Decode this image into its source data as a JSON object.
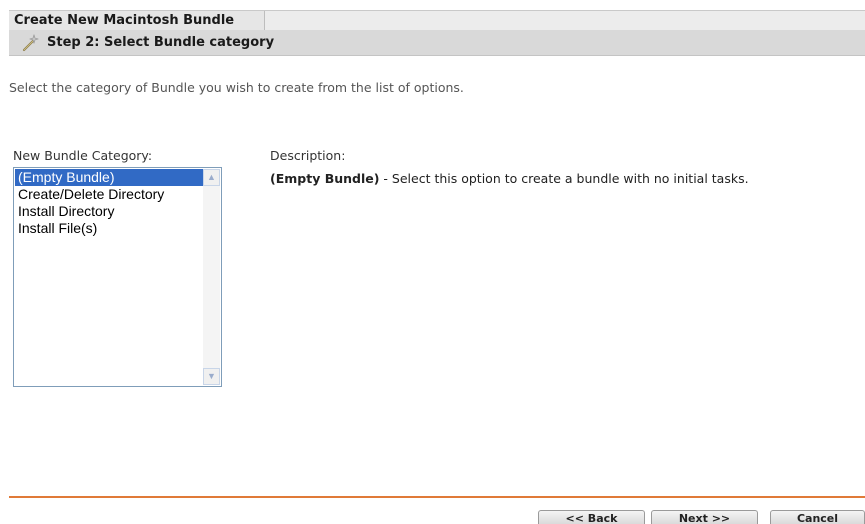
{
  "header": {
    "title": "Create New Macintosh Bundle",
    "step_title": "Step 2: Select Bundle category",
    "step_icon": "wand-icon"
  },
  "intro_text": "Select the category of Bundle you wish to create from the list of options.",
  "category_list": {
    "label": "New Bundle Category:",
    "items": [
      {
        "label": "(Empty Bundle)",
        "selected": true
      },
      {
        "label": "Create/Delete Directory",
        "selected": false
      },
      {
        "label": "Install Directory",
        "selected": false
      },
      {
        "label": "Install File(s)",
        "selected": false
      }
    ]
  },
  "description": {
    "label": "Description:",
    "name": "(Empty Bundle)",
    "text": " - Select this option to create a bundle with no initial tasks."
  },
  "buttons": {
    "back": "<< Back",
    "next": "Next >>",
    "cancel": "Cancel"
  },
  "colors": {
    "selection": "#316ac5",
    "divider": "#e07a38"
  }
}
